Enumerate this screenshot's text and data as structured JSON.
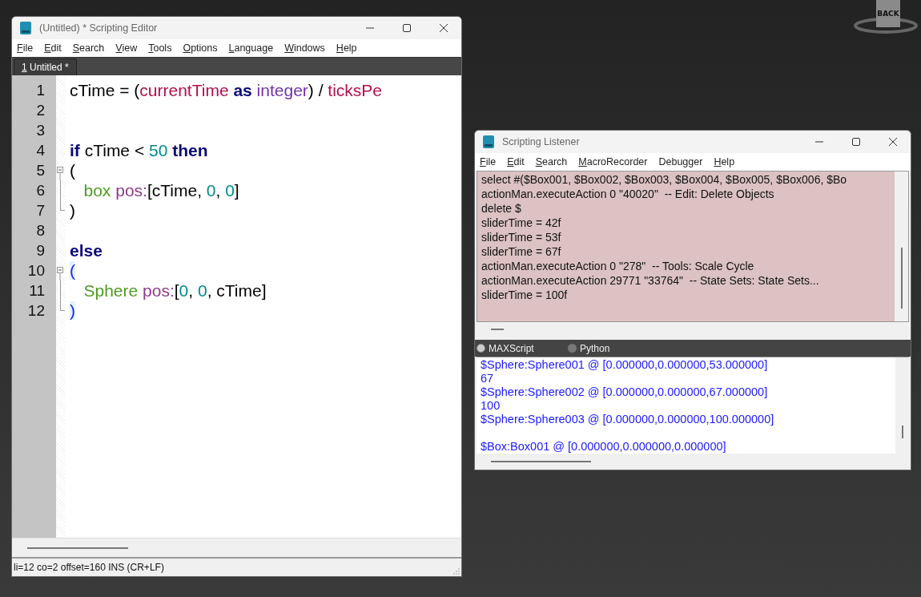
{
  "editor": {
    "title": "(Untitled) * Scripting Editor",
    "menu": [
      {
        "label": "File",
        "mnemonic": true
      },
      {
        "label": "Edit",
        "mnemonic": true
      },
      {
        "label": "Search",
        "mnemonic": true
      },
      {
        "label": "View",
        "mnemonic": true
      },
      {
        "label": "Tools",
        "mnemonic": true
      },
      {
        "label": "Options",
        "mnemonic": true
      },
      {
        "label": "Language",
        "mnemonic": true
      },
      {
        "label": "Windows",
        "mnemonic": true
      },
      {
        "label": "Help",
        "mnemonic": true
      }
    ],
    "tabs": [
      {
        "label": "1 Untitled *",
        "selected": true,
        "mnemonic": true
      }
    ],
    "lines": [
      {
        "number": "1",
        "kind": "plain",
        "tokens": [
          {
            "kind": "plain",
            "text": "cTime = ("
          },
          {
            "kind": "global",
            "text": "currentTime"
          },
          {
            "kind": "keyword",
            "text": " as"
          },
          {
            "kind": "type",
            "text": " integer"
          },
          {
            "kind": "plain",
            "text": ") / "
          },
          {
            "kind": "global",
            "text": "ticksPe"
          }
        ]
      },
      {
        "number": "2",
        "kind": "plain"
      },
      {
        "number": "3",
        "kind": "plain"
      },
      {
        "number": "4",
        "kind": "plain",
        "tokens": [
          {
            "kind": "keyword",
            "text": "if"
          },
          {
            "kind": "plain",
            "text": " cTime < "
          },
          {
            "kind": "number",
            "text": "50"
          },
          {
            "kind": "keyword",
            "text": " then"
          }
        ]
      },
      {
        "number": "5",
        "kind": "fold_start",
        "tokens": [
          {
            "kind": "plain",
            "text": "("
          }
        ]
      },
      {
        "number": "6",
        "kind": "fold_body",
        "tokens": [
          {
            "kind": "class",
            "text": "   box"
          },
          {
            "kind": "property",
            "text": " pos:"
          },
          {
            "kind": "plain",
            "text": "[cTime, "
          },
          {
            "kind": "number",
            "text": "0"
          },
          {
            "kind": "plain",
            "text": ", "
          },
          {
            "kind": "number",
            "text": "0"
          },
          {
            "kind": "plain",
            "text": "]"
          }
        ]
      },
      {
        "number": "7",
        "kind": "fold_end",
        "tokens": [
          {
            "kind": "plain",
            "text": ")"
          }
        ]
      },
      {
        "number": "8",
        "kind": "plain"
      },
      {
        "number": "9",
        "kind": "plain",
        "tokens": [
          {
            "kind": "keyword",
            "text": "else"
          }
        ]
      },
      {
        "number": "10",
        "kind": "fold_start",
        "tokens": [
          {
            "kind": "brace_match",
            "text": "("
          }
        ]
      },
      {
        "number": "11",
        "kind": "fold_body",
        "tokens": [
          {
            "kind": "class",
            "text": "   Sphere"
          },
          {
            "kind": "property",
            "text": " pos:"
          },
          {
            "kind": "plain",
            "text": "["
          },
          {
            "kind": "number",
            "text": "0"
          },
          {
            "kind": "plain",
            "text": ", "
          },
          {
            "kind": "number",
            "text": "0"
          },
          {
            "kind": "plain",
            "text": ", cTime]"
          }
        ]
      },
      {
        "number": "12",
        "kind": "fold_end",
        "tokens": [
          {
            "kind": "brace_match",
            "text": ")"
          }
        ]
      }
    ],
    "status_bar": "li=12 co=2 offset=160 INS (CR+LF)"
  },
  "listener": {
    "title": "Scripting Listener",
    "menu": [
      {
        "label": "File",
        "mnemonic": true
      },
      {
        "label": "Edit",
        "mnemonic": true
      },
      {
        "label": "Search",
        "mnemonic": true
      },
      {
        "label": "MacroRecorder",
        "mnemonic": true
      },
      {
        "label": "Debugger",
        "mnemonic": false
      },
      {
        "label": "Help",
        "mnemonic": true
      }
    ],
    "macro_output": [
      "select #($Box001, $Box002, $Box003, $Box004, $Box005, $Box006, $Bo",
      "actionMan.executeAction 0 \"40020\"  -- Edit: Delete Objects",
      "delete $",
      "sliderTime = 42f",
      "sliderTime = 53f",
      "sliderTime = 67f",
      "actionMan.executeAction 0 \"278\"  -- Tools: Scale Cycle",
      "actionMan.executeAction 29771 \"33764\"  -- State Sets: State Sets...",
      "sliderTime = 100f"
    ],
    "languages": [
      {
        "label": "MAXScript",
        "selected": true
      },
      {
        "label": "Python",
        "selected": false
      }
    ],
    "output_blocks": [
      {
        "lines": [
          "$Sphere:Sphere001 @ [0.000000,0.000000,53.000000]",
          "67",
          "$Sphere:Sphere002 @ [0.000000,0.000000,67.000000]",
          "100",
          "$Sphere:Sphere003 @ [0.000000,0.000000,100.000000]"
        ]
      },
      {
        "lines": [
          "$Box:Box001 @ [0.000000,0.000000,0.000000]"
        ]
      }
    ]
  },
  "viewcube": {
    "face": "BACK"
  }
}
